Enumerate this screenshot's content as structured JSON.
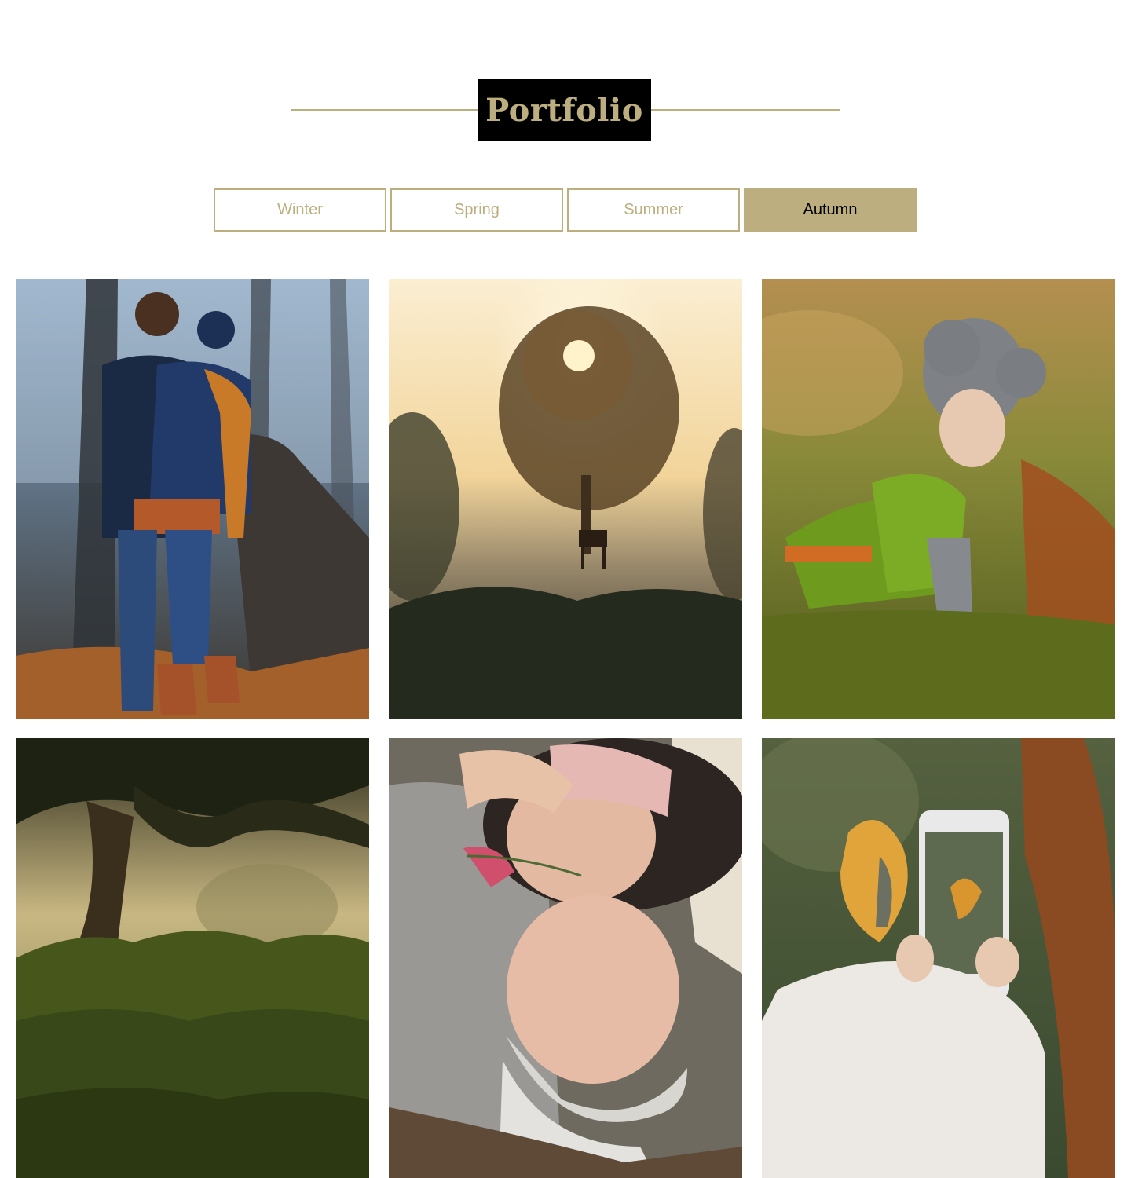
{
  "header": {
    "title": "Portfolio"
  },
  "tabs": [
    {
      "label": "Winter",
      "active": false
    },
    {
      "label": "Spring",
      "active": false
    },
    {
      "label": "Summer",
      "active": false
    },
    {
      "label": "Autumn",
      "active": true
    }
  ],
  "colors": {
    "accent": "#bdae7f",
    "title_bg": "#000000",
    "page_bg": "#ffffff"
  },
  "gallery": {
    "items": [
      {
        "subject": "couple-kissing-in-forest"
      },
      {
        "subject": "sunrise-tree-with-horse"
      },
      {
        "subject": "baby-in-knitted-hat-in-grass"
      },
      {
        "subject": "mossy-forest-with-old-tree"
      },
      {
        "subject": "smiling-senior-couple-with-flowers"
      },
      {
        "subject": "phone-photographing-autumn-leaves"
      }
    ]
  }
}
